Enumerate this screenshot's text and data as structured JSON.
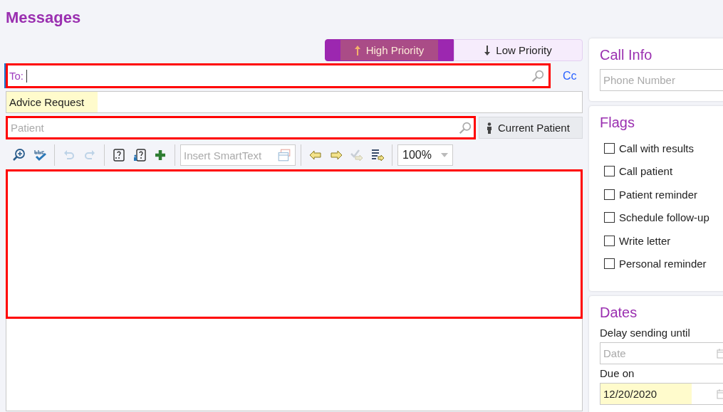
{
  "title": "Messages",
  "priority": [
    {
      "label": "High Priority",
      "kind": "up",
      "selected": true
    },
    {
      "label": "Low Priority",
      "kind": "down",
      "selected": false
    }
  ],
  "to": {
    "label": "To:",
    "highlighted": true
  },
  "cc": "Cc",
  "subject": {
    "value": "Advice Request"
  },
  "patient": {
    "placeholder": "Patient",
    "highlighted": true
  },
  "current_patient": "Current Patient",
  "toolbar": [
    {
      "kind": "zoom",
      "disabled": false
    },
    {
      "kind": "spell",
      "disabled": false
    },
    {
      "kind": "sep"
    },
    {
      "kind": "undo",
      "disabled": true
    },
    {
      "kind": "redo",
      "disabled": true
    },
    {
      "kind": "sep"
    },
    {
      "kind": "question",
      "disabled": false
    },
    {
      "kind": "person-question",
      "disabled": false
    },
    {
      "kind": "plus",
      "disabled": false
    },
    {
      "kind": "sep"
    },
    {
      "kind": "smarttext",
      "placeholder": "Insert SmartText"
    },
    {
      "kind": "sep"
    },
    {
      "kind": "left",
      "disabled": false
    },
    {
      "kind": "right",
      "disabled": false
    },
    {
      "kind": "check-arrow",
      "disabled": true
    },
    {
      "kind": "list-arrow",
      "disabled": false
    },
    {
      "kind": "sep"
    },
    {
      "kind": "zoom-select",
      "value": "100%"
    }
  ],
  "body": {
    "highlighted": true
  },
  "call_info": {
    "title": "Call Info",
    "phone": {
      "placeholder": "Phone Number"
    }
  },
  "flags": {
    "title": "Flags",
    "items": [
      {
        "label": "Call with results",
        "checked": false
      },
      {
        "label": "Call patient",
        "checked": false
      },
      {
        "label": "Patient reminder",
        "checked": false
      },
      {
        "label": "Schedule follow-up",
        "checked": false
      },
      {
        "label": "Write letter",
        "checked": false
      },
      {
        "label": "Personal reminder",
        "checked": false
      }
    ]
  },
  "dates": {
    "title": "Dates",
    "fields": [
      {
        "label": "Delay sending until",
        "placeholder": "Date"
      },
      {
        "label": "Due on",
        "value": "12/20/2020"
      }
    ]
  }
}
